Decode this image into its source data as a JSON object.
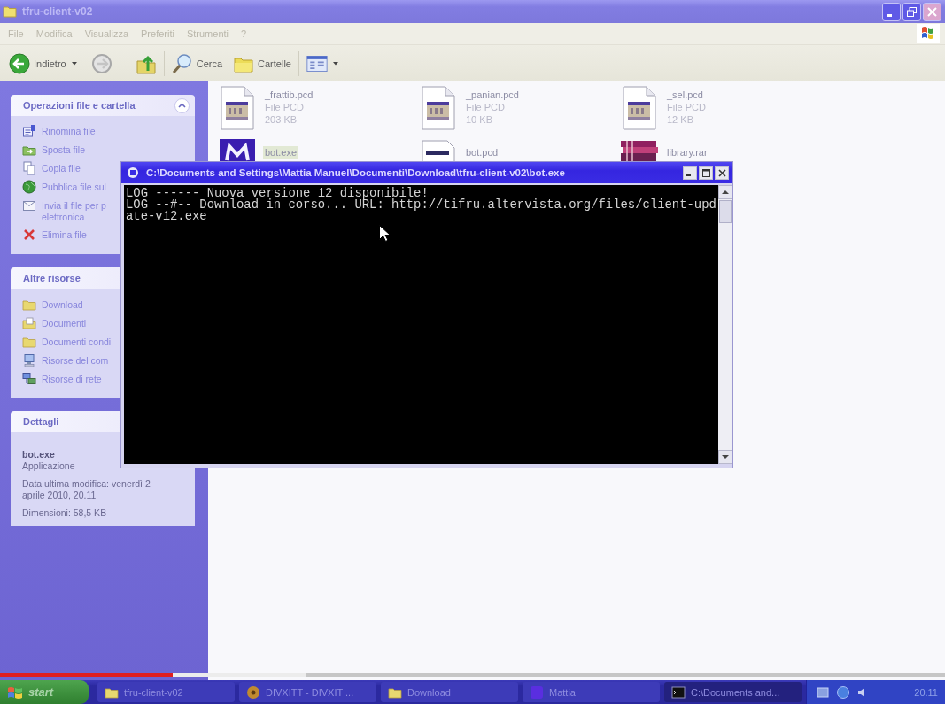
{
  "window": {
    "title": "tfru-client-v02"
  },
  "menu": [
    "File",
    "Modifica",
    "Visualizza",
    "Preferiti",
    "Strumenti",
    "?"
  ],
  "toolbar": [
    {
      "kind": "back",
      "label": "Indietro"
    },
    {
      "kind": "forward"
    },
    {
      "kind": "up"
    },
    {
      "kind": "search",
      "label": "Cerca"
    },
    {
      "kind": "folders",
      "label": "Cartelle"
    },
    {
      "kind": "views"
    }
  ],
  "sidebar": [
    {
      "kind": "links",
      "title": "Operazioni file e cartella",
      "expanded": true,
      "items": [
        {
          "kind": "rename",
          "lines": [
            "Rinomina file"
          ]
        },
        {
          "kind": "move",
          "lines": [
            "Sposta file"
          ]
        },
        {
          "kind": "copy",
          "lines": [
            "Copia file"
          ]
        },
        {
          "kind": "publish",
          "lines": [
            "Pubblica file sul"
          ]
        },
        {
          "kind": "email",
          "lines": [
            "Invia il file per p",
            "elettronica"
          ]
        },
        {
          "kind": "delete",
          "lines": [
            "Elimina file"
          ]
        }
      ]
    },
    {
      "kind": "links",
      "title": "Altre risorse",
      "items": [
        {
          "kind": "folder",
          "lines": [
            "Download"
          ]
        },
        {
          "kind": "documents",
          "lines": [
            "Documenti"
          ]
        },
        {
          "kind": "folder",
          "lines": [
            "Documenti condi"
          ]
        },
        {
          "kind": "computer",
          "lines": [
            "Risorse del com"
          ]
        },
        {
          "kind": "network",
          "lines": [
            "Risorse di rete"
          ]
        }
      ]
    },
    {
      "kind": "details",
      "title": "Dettagli",
      "name": "bot.exe",
      "type": "Applicazione",
      "lines": [
        "Data ultima modifica: venerdì 2 aprile 2010, 20.11",
        "Dimensioni: 58,5 KB"
      ]
    }
  ],
  "files": [
    {
      "kind": "image",
      "name": "_frattib.pcd",
      "type": "File PCD",
      "size": "203 KB",
      "selected": false
    },
    {
      "kind": "image",
      "name": "_panian.pcd",
      "type": "File PCD",
      "size": "10 KB",
      "selected": false
    },
    {
      "kind": "image",
      "name": "_sel.pcd",
      "type": "File PCD",
      "size": "12 KB",
      "selected": false
    },
    {
      "kind": "application",
      "name": "bot.exe",
      "selected": true
    },
    {
      "kind": "document",
      "name": "bot.pcd",
      "selected": false
    },
    {
      "kind": "archive",
      "name": "library.rar",
      "selected": false
    }
  ],
  "console": {
    "title": "C:\\Documents and Settings\\Mattia Manuel\\Documenti\\Download\\tfru-client-v02\\bot.exe",
    "lines": [
      "LOG ------ Nuova versione 12 disponibile!",
      "LOG --#-- Download in corso... URL: http://tifru.altervista.org/files/client-upd",
      "ate-v12.exe"
    ]
  },
  "video_player": {
    "progress": {
      "level": 0.183
    },
    "buffer": {
      "level": 0.323
    }
  },
  "taskbar": {
    "start": "start",
    "buttons": [
      {
        "kind": "folder",
        "label": "tfru-client-v02",
        "selected": false
      },
      {
        "kind": "media",
        "label": "DIVXITT - DIVXIT ...",
        "selected": false
      },
      {
        "kind": "folder",
        "label": "Download",
        "selected": false
      },
      {
        "kind": "chat",
        "label": "Mattia",
        "selected": false
      },
      {
        "kind": "console",
        "label": "C:\\Documents and...",
        "selected": true
      }
    ],
    "clock": "20.11"
  }
}
